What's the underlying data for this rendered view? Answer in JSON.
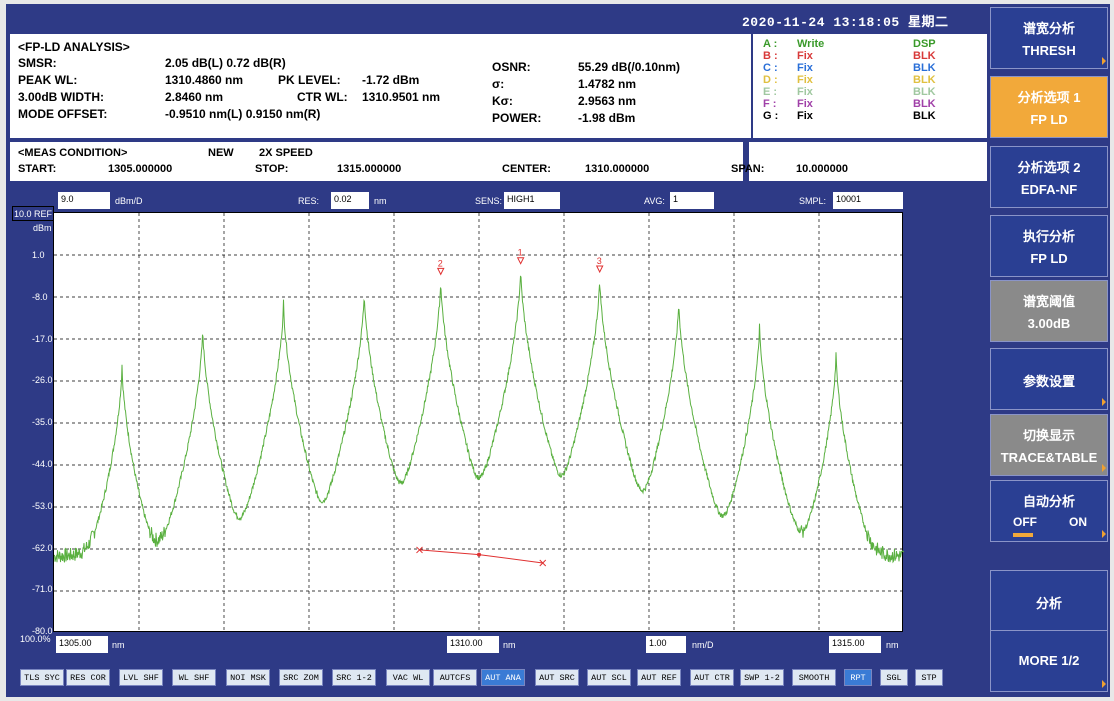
{
  "datetime": "2020-11-24 13:18:05 星期二",
  "analysis": {
    "title": "<FP-LD ANALYSIS>",
    "smsr_label": "SMSR:",
    "smsr_value": "2.05 dB(L)  0.72 dB(R)",
    "peakwl_label": "PEAK WL:",
    "peakwl_value": "1310.4860 nm",
    "pklevel_label": "PK LEVEL:",
    "pklevel_value": "-1.72 dBm",
    "width_label": "3.00dB WIDTH:",
    "width_value": "2.8460 nm",
    "ctrwl_label": "CTR WL:",
    "ctrwl_value": "1310.9501 nm",
    "offset_label": "MODE OFFSET:",
    "offset_value": "-0.9510 nm(L)  0.9150 nm(R)",
    "osnr_label": "OSNR:",
    "osnr_value": "55.29 dB(/0.10nm)",
    "sigma_label": "σ:",
    "sigma_value": "1.4782 nm",
    "ksigma_label": "Kσ:",
    "ksigma_value": "2.9563 nm",
    "power_label": "POWER:",
    "power_value": "-1.98 dBm"
  },
  "traces": [
    {
      "id": "A :",
      "mode": "Write",
      "disp": "DSP",
      "color": "#3a9a2a",
      "disp_color": "#3a9a2a"
    },
    {
      "id": "B :",
      "mode": "Fix",
      "disp": "BLK",
      "color": "#d83a3a",
      "disp_color": "#d83a3a"
    },
    {
      "id": "C :",
      "mode": "Fix",
      "disp": "BLK",
      "color": "#2a6fd8",
      "disp_color": "#2a6fd8"
    },
    {
      "id": "D :",
      "mode": "Fix",
      "disp": "BLK",
      "color": "#e0c040",
      "disp_color": "#e0c040"
    },
    {
      "id": "E :",
      "mode": "Fix",
      "disp": "BLK",
      "color": "#a0c8a0",
      "disp_color": "#a0c8a0"
    },
    {
      "id": "F :",
      "mode": "Fix",
      "disp": "BLK",
      "color": "#a040a8",
      "disp_color": "#a040a8"
    },
    {
      "id": "G :",
      "mode": "Fix",
      "disp": "BLK",
      "color": "#000000",
      "disp_color": "#000000"
    }
  ],
  "meas": {
    "title": "<MEAS CONDITION>",
    "new": "NEW",
    "speed": "2X SPEED",
    "start_label": "START:",
    "start_value": "1305.000000",
    "stop_label": "STOP:",
    "stop_value": "1315.000000",
    "center_label": "CENTER:",
    "center_value": "1310.000000",
    "span_label": "SPAN:",
    "span_value": "10.000000"
  },
  "params": {
    "scale_value": "9.0",
    "scale_unit": "dBm/D",
    "res_label": "RES:",
    "res_value": "0.02",
    "res_unit": "nm",
    "sens_label": "SENS:",
    "sens_value": "HIGH1",
    "avg_label": "AVG:",
    "avg_value": "1",
    "smpl_label": "SMPL:",
    "smpl_value": "10001"
  },
  "axis": {
    "ref_label": "10.0",
    "ref_suffix": "REF",
    "ref_unit": "dBm",
    "yticks": [
      "1.0",
      "-8.0",
      "-17.0",
      "-26.0",
      "-35.0",
      "-44.0",
      "-53.0",
      "-62.0",
      "-71.0",
      "-80.0"
    ],
    "pct_label": "100.0%",
    "x_start": "1305.00",
    "x_start_unit": "nm",
    "x_center": "1310.00",
    "x_center_unit": "nm",
    "x_div": "1.00",
    "x_div_unit": "nm/D",
    "x_stop": "1315.00",
    "x_stop_unit": "nm"
  },
  "markers": [
    "2",
    "1",
    "3"
  ],
  "bottom_buttons": [
    "TLS SYC",
    "RES COR",
    "LVL SHF",
    "WL SHF",
    "NOI MSK",
    "SRC ZOM",
    "SRC 1-2",
    "VAC WL",
    "AUTCFS",
    "AUT ANA",
    "AUT SRC",
    "AUT SCL",
    "AUT REF",
    "AUT CTR",
    "SWP 1-2",
    "SMOOTH",
    "RPT",
    "SGL",
    "STP"
  ],
  "softkeys": [
    {
      "l1": "谱宽分析",
      "l2": "THRESH"
    },
    {
      "l1": "分析选项 1",
      "l2": "FP LD"
    },
    {
      "l1": "分析选项 2",
      "l2": "EDFA-NF"
    },
    {
      "l1": "执行分析",
      "l2": "FP LD"
    },
    {
      "l1": "谱宽阈值",
      "l2": "3.00dB"
    },
    {
      "l1": "参数设置",
      "l2": ""
    },
    {
      "l1": "切换显示",
      "l2": "TRACE&TABLE"
    },
    {
      "l1": "自动分析",
      "l2_off": "OFF",
      "l2_on": "ON"
    },
    {
      "l1": "分析",
      "l2": ""
    },
    {
      "l1": "MORE 1/2",
      "l2": ""
    }
  ],
  "chart_data": {
    "type": "line",
    "xlim": [
      1305,
      1315
    ],
    "ylim": [
      -80,
      10
    ],
    "peaks_x": [
      1305.8,
      1306.75,
      1307.7,
      1308.65,
      1309.55,
      1310.49,
      1311.42,
      1312.35,
      1313.3,
      1314.2
    ],
    "peaks_y": [
      -22.5,
      -14.5,
      -9.0,
      -6.5,
      -4.0,
      -1.72,
      -3.5,
      -8.5,
      -14.0,
      -20.0
    ],
    "floor_y": -63.5,
    "trace_color": "#5ab040"
  }
}
